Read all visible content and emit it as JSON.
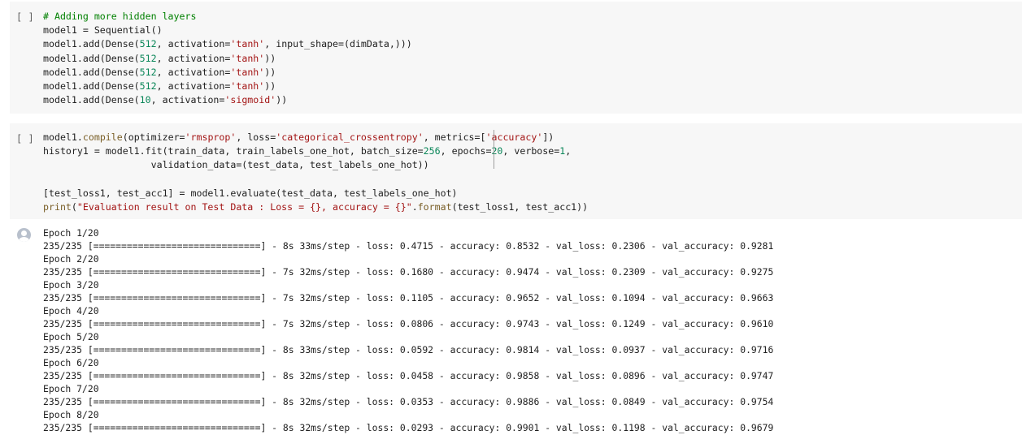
{
  "cell1": {
    "run_label": "[ ]",
    "lines": [
      [
        {
          "t": "# Adding more hidden layers",
          "c": "cm"
        }
      ],
      [
        {
          "t": "model1 = Sequential()",
          "c": ""
        }
      ],
      [
        {
          "t": "model1.add(Dense(",
          "c": ""
        },
        {
          "t": "512",
          "c": "num"
        },
        {
          "t": ", activation=",
          "c": ""
        },
        {
          "t": "'tanh'",
          "c": "str"
        },
        {
          "t": ", input_shape=(dimData,)))",
          "c": ""
        }
      ],
      [
        {
          "t": "model1.add(Dense(",
          "c": ""
        },
        {
          "t": "512",
          "c": "num"
        },
        {
          "t": ", activation=",
          "c": ""
        },
        {
          "t": "'tanh'",
          "c": "str"
        },
        {
          "t": "))",
          "c": ""
        }
      ],
      [
        {
          "t": "model1.add(Dense(",
          "c": ""
        },
        {
          "t": "512",
          "c": "num"
        },
        {
          "t": ", activation=",
          "c": ""
        },
        {
          "t": "'tanh'",
          "c": "str"
        },
        {
          "t": "))",
          "c": ""
        }
      ],
      [
        {
          "t": "model1.add(Dense(",
          "c": ""
        },
        {
          "t": "512",
          "c": "num"
        },
        {
          "t": ", activation=",
          "c": ""
        },
        {
          "t": "'tanh'",
          "c": "str"
        },
        {
          "t": "))",
          "c": ""
        }
      ],
      [
        {
          "t": "model1.add(Dense(",
          "c": ""
        },
        {
          "t": "10",
          "c": "num"
        },
        {
          "t": ", activation=",
          "c": ""
        },
        {
          "t": "'sigmoid'",
          "c": "str"
        },
        {
          "t": "))",
          "c": ""
        }
      ]
    ]
  },
  "cell2": {
    "run_label": "[ ]",
    "lines": [
      [
        {
          "t": "model1.",
          "c": ""
        },
        {
          "t": "compile",
          "c": "fn"
        },
        {
          "t": "(optimizer=",
          "c": ""
        },
        {
          "t": "'rmsprop'",
          "c": "str"
        },
        {
          "t": ", loss=",
          "c": ""
        },
        {
          "t": "'categorical_crossentropy'",
          "c": "str"
        },
        {
          "t": ", metrics=[",
          "c": ""
        },
        {
          "t": "'accuracy'",
          "c": "str"
        },
        {
          "t": "])",
          "c": ""
        }
      ],
      [
        {
          "t": "history1 = model1.fit(train_data, train_labels_one_hot, batch_size=",
          "c": ""
        },
        {
          "t": "256",
          "c": "num"
        },
        {
          "t": ", epochs=",
          "c": ""
        },
        {
          "t": "20",
          "c": "num"
        },
        {
          "t": ", verbose=",
          "c": ""
        },
        {
          "t": "1",
          "c": "num"
        },
        {
          "t": ",",
          "c": ""
        }
      ],
      [
        {
          "t": "                   validation_data=(test_data, test_labels_one_hot))",
          "c": ""
        }
      ],
      [
        {
          "t": "",
          "c": ""
        }
      ],
      [
        {
          "t": "[test_loss1, test_acc1] = model1.evaluate(test_data, test_labels_one_hot)",
          "c": ""
        }
      ],
      [
        {
          "t": "print",
          "c": "fn"
        },
        {
          "t": "(",
          "c": ""
        },
        {
          "t": "\"Evaluation result on Test Data : Loss = {}, accuracy = {}\"",
          "c": "str"
        },
        {
          "t": ".",
          "c": ""
        },
        {
          "t": "format",
          "c": "fn"
        },
        {
          "t": "(test_loss1, test_acc1))",
          "c": ""
        }
      ]
    ]
  },
  "output": {
    "lines": [
      "Epoch 1/20",
      "235/235 [==============================] - 8s 33ms/step - loss: 0.4715 - accuracy: 0.8532 - val_loss: 0.2306 - val_accuracy: 0.9281",
      "Epoch 2/20",
      "235/235 [==============================] - 7s 32ms/step - loss: 0.1680 - accuracy: 0.9474 - val_loss: 0.2309 - val_accuracy: 0.9275",
      "Epoch 3/20",
      "235/235 [==============================] - 7s 32ms/step - loss: 0.1105 - accuracy: 0.9652 - val_loss: 0.1094 - val_accuracy: 0.9663",
      "Epoch 4/20",
      "235/235 [==============================] - 7s 32ms/step - loss: 0.0806 - accuracy: 0.9743 - val_loss: 0.1249 - val_accuracy: 0.9610",
      "Epoch 5/20",
      "235/235 [==============================] - 8s 33ms/step - loss: 0.0592 - accuracy: 0.9814 - val_loss: 0.0937 - val_accuracy: 0.9716",
      "Epoch 6/20",
      "235/235 [==============================] - 8s 32ms/step - loss: 0.0458 - accuracy: 0.9858 - val_loss: 0.0896 - val_accuracy: 0.9747",
      "Epoch 7/20",
      "235/235 [==============================] - 8s 32ms/step - loss: 0.0353 - accuracy: 0.9886 - val_loss: 0.0849 - val_accuracy: 0.9754",
      "Epoch 8/20",
      "235/235 [==============================] - 8s 32ms/step - loss: 0.0293 - accuracy: 0.9901 - val_loss: 0.1198 - val_accuracy: 0.9679"
    ]
  }
}
